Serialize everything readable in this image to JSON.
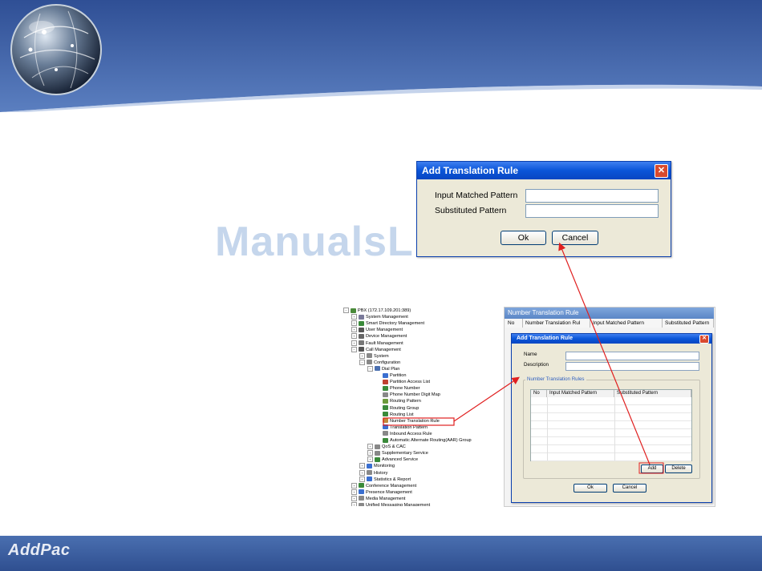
{
  "footer": {
    "brand": "AddPac"
  },
  "watermark": "ManualsLib.com",
  "main_dialog": {
    "title": "Add Translation Rule",
    "input_matched_label": "Input Matched Pattern",
    "input_matched_value": "",
    "substituted_label": "Substituted Pattern",
    "substituted_value": "",
    "ok_label": "Ok",
    "cancel_label": "Cancel"
  },
  "tree": {
    "items": [
      {
        "label": "PBX (172.17.109.201:389)",
        "exp": "−",
        "color": "#4a8a3a"
      },
      {
        "label": "System Management",
        "exp": "+",
        "color": "#7a7a9a"
      },
      {
        "label": "Smart Directory Management",
        "exp": "+",
        "color": "#3a8a3a"
      },
      {
        "label": "User Management",
        "exp": "+",
        "color": "#555"
      },
      {
        "label": "Device Management",
        "exp": "+",
        "color": "#666"
      },
      {
        "label": "Fault Management",
        "exp": "+",
        "color": "#777"
      },
      {
        "label": "Call Management",
        "exp": "−",
        "color": "#555"
      },
      {
        "label": "System",
        "exp": "+",
        "color": "#888"
      },
      {
        "label": "Configuration",
        "exp": "−",
        "color": "#888"
      },
      {
        "label": "Dial Plan",
        "exp": "−",
        "color": "#4a6fb0"
      },
      {
        "label": "Partition",
        "exp": "",
        "color": "#3a6fd0"
      },
      {
        "label": "Partition Access List",
        "exp": "",
        "color": "#c04030"
      },
      {
        "label": "Phone Number",
        "exp": "",
        "color": "#3a8a3a"
      },
      {
        "label": "Phone Number Digit Map",
        "exp": "",
        "color": "#888"
      },
      {
        "label": "Routing Pattern",
        "exp": "",
        "color": "#6a9a3a"
      },
      {
        "label": "Routing Group",
        "exp": "",
        "color": "#3a8a3a"
      },
      {
        "label": "Routing List",
        "exp": "",
        "color": "#3a8a3a"
      },
      {
        "label": "Number Translation Rule",
        "exp": "",
        "color": "#c08a3a"
      },
      {
        "label": "Translation Pattern",
        "exp": "",
        "color": "#3a6fd0"
      },
      {
        "label": "Inbound Access Rule",
        "exp": "",
        "color": "#888"
      },
      {
        "label": "Automatic Alternate Routing(AAR) Group",
        "exp": "",
        "color": "#3a8a3a"
      },
      {
        "label": "QoS & CAC",
        "exp": "+",
        "color": "#888"
      },
      {
        "label": "Supplementary Service",
        "exp": "+",
        "color": "#888"
      },
      {
        "label": "Advanced Service",
        "exp": "+",
        "color": "#3a8a3a"
      },
      {
        "label": "Monitoring",
        "exp": "+",
        "color": "#3a6fd0"
      },
      {
        "label": "History",
        "exp": "+",
        "color": "#888"
      },
      {
        "label": "Statistics & Report",
        "exp": "+",
        "color": "#3a6fd0"
      },
      {
        "label": "Conference Management",
        "exp": "+",
        "color": "#3a8a3a"
      },
      {
        "label": "Presence Management",
        "exp": "+",
        "color": "#3a6fd0"
      },
      {
        "label": "Media Management",
        "exp": "+",
        "color": "#888"
      },
      {
        "label": "Unified Messaging Management",
        "exp": "+",
        "color": "#888"
      }
    ]
  },
  "panel": {
    "title": "Number Translation Rule",
    "columns": [
      "No",
      "Number Translation Rul",
      "Input Matched Pattern",
      "Substituted Pattern"
    ]
  },
  "sub_dialog": {
    "title": "Add Translation Rule",
    "name_label": "Name",
    "description_label": "Description",
    "group_label": "Number Translation Rules",
    "grid_columns": [
      "No",
      "Input Matched Pattern",
      "Substituted Pattern"
    ],
    "add_label": "Add",
    "delete_label": "Delete",
    "ok_label": "Ok",
    "cancel_label": "Cancel"
  },
  "colors": {
    "banner_blue": "#3f62a8",
    "titlebar_blue": "#0a55d8",
    "highlight_red": "#e02020"
  }
}
